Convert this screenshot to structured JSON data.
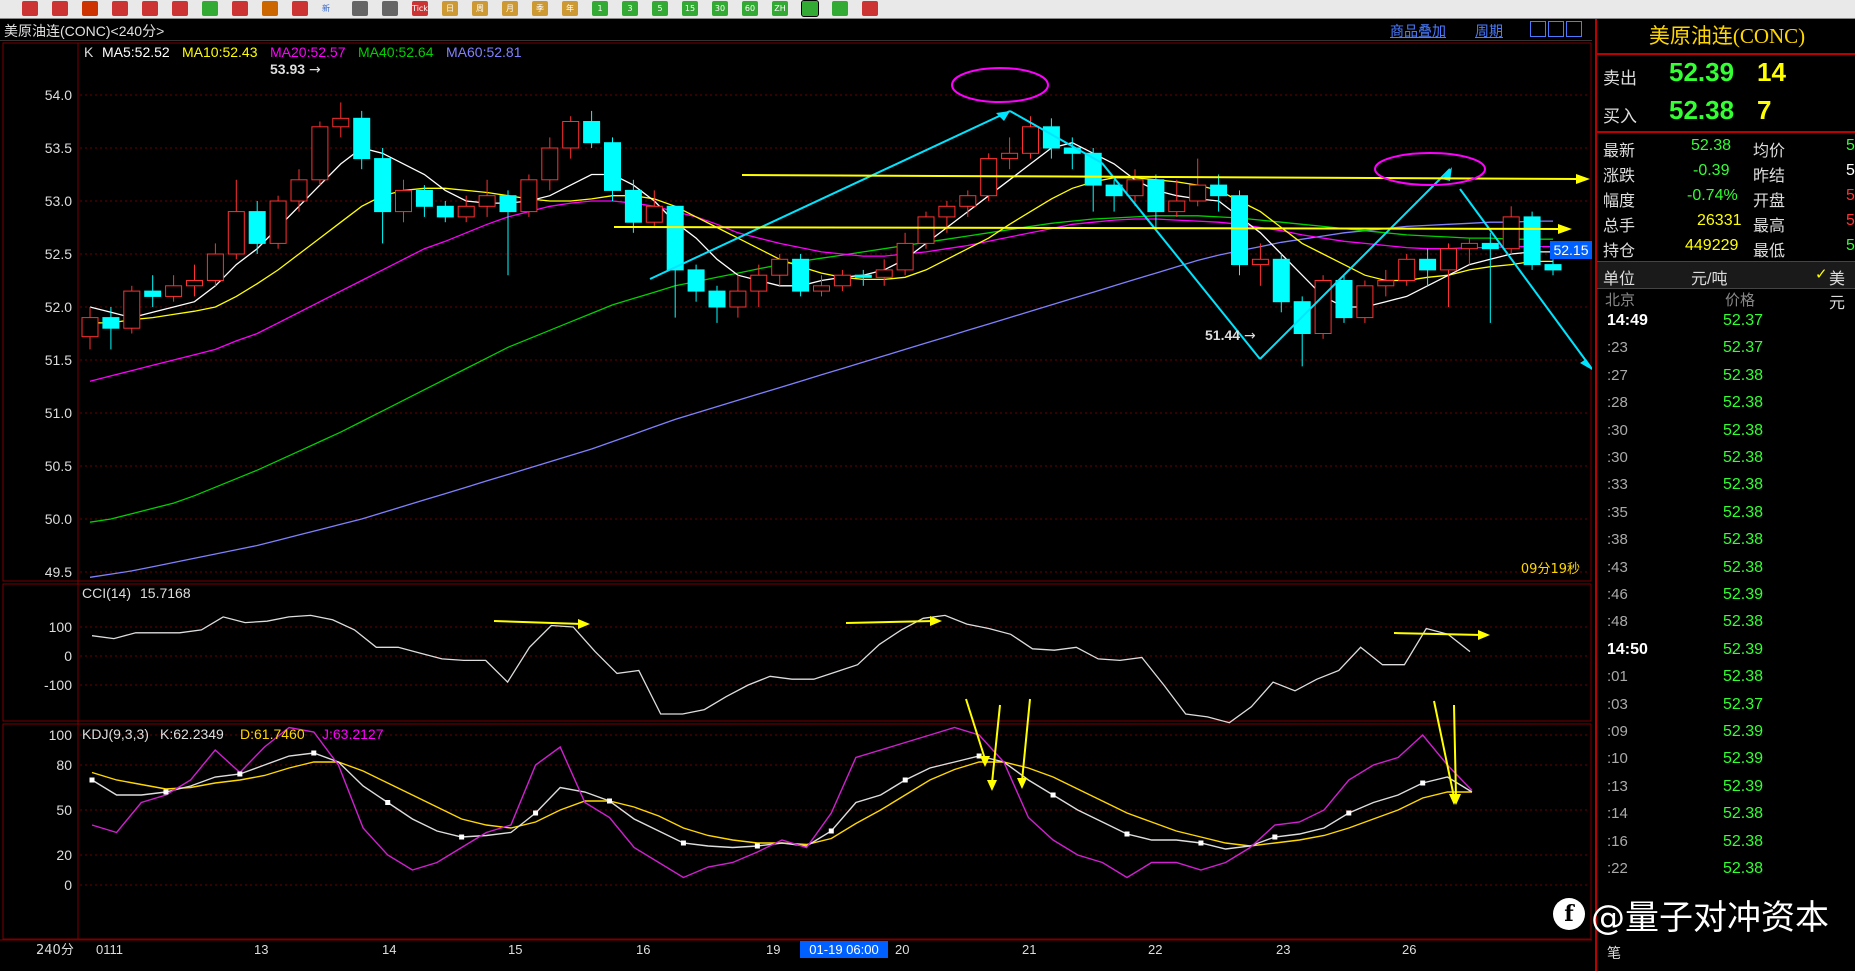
{
  "toolbar": {
    "tick_label": "Tick",
    "day_label": "日",
    "week_label": "周",
    "month_label": "月",
    "season_label": "季",
    "year_label": "年",
    "m1": "1",
    "m3": "3",
    "m5": "5",
    "m15": "15",
    "m30": "30",
    "m60": "60",
    "zh_label": "ZH",
    "fen_label": "新"
  },
  "header": {
    "title": "美原油连(CONC)<240分>",
    "overlay_link": "商品叠加",
    "period_link": "周期"
  },
  "main_legend": {
    "k": "K",
    "ma5": "MA5:52.52",
    "ma10": "MA10:52.43",
    "ma20": "MA20:52.57",
    "ma40": "MA40:52.64",
    "ma60": "MA60:52.81"
  },
  "colors": {
    "up": "#ff3030",
    "down": "#00ffff",
    "ma5": "#ffffff",
    "ma10": "#ffff00",
    "ma20": "#ff00ff",
    "ma40": "#00d000",
    "ma60": "#8080ff",
    "annotation_cyan": "#00e5ff",
    "annotation_yellow": "#ffff00",
    "annotation_magenta": "#ff00ff"
  },
  "annotations": {
    "high_label": "53.93",
    "low_label": "51.44",
    "current_price_tag": "52.15",
    "countdown": "09分19秒"
  },
  "cci": {
    "legend_name": "CCI(14)",
    "legend_value": "15.7168",
    "y_ticks": [
      "100",
      "0",
      "-100"
    ]
  },
  "kdj": {
    "legend_name": "KDJ(9,3,3)",
    "k": "K:62.2349",
    "d": "D:61.7460",
    "j": "J:63.2127",
    "y_ticks": [
      "100",
      "80",
      "50",
      "20",
      "0"
    ]
  },
  "xaxis": {
    "period": "240分",
    "labels": [
      "0111",
      "13",
      "14",
      "15",
      "16",
      "19",
      "20",
      "21",
      "22",
      "23",
      "26"
    ],
    "cursor_label": "01-19 06:00"
  },
  "chart_data": {
    "type": "candlestick",
    "ylim": [
      49.3,
      54.1
    ],
    "y_ticks": [
      "54.0",
      "53.5",
      "53.0",
      "52.5",
      "52.0",
      "51.5",
      "51.0",
      "50.5",
      "50.0",
      "49.5"
    ],
    "candles": [
      [
        51.72,
        51.9,
        51.6,
        52.0
      ],
      [
        51.9,
        51.8,
        51.6,
        52.0
      ],
      [
        51.8,
        52.15,
        51.75,
        52.2
      ],
      [
        52.15,
        52.1,
        52.0,
        52.3
      ],
      [
        52.1,
        52.2,
        52.05,
        52.3
      ],
      [
        52.2,
        52.25,
        52.1,
        52.4
      ],
      [
        52.25,
        52.5,
        52.2,
        52.6
      ],
      [
        52.5,
        52.9,
        52.45,
        53.2
      ],
      [
        52.9,
        52.6,
        52.5,
        53.0
      ],
      [
        52.6,
        53.0,
        52.55,
        53.05
      ],
      [
        53.0,
        53.2,
        52.9,
        53.3
      ],
      [
        53.2,
        53.7,
        53.15,
        53.75
      ],
      [
        53.7,
        53.78,
        53.6,
        53.93
      ],
      [
        53.78,
        53.4,
        53.3,
        53.85
      ],
      [
        53.4,
        52.9,
        52.6,
        53.5
      ],
      [
        52.9,
        53.1,
        52.8,
        53.2
      ],
      [
        53.1,
        52.95,
        52.85,
        53.15
      ],
      [
        52.95,
        52.85,
        52.8,
        53.0
      ],
      [
        52.85,
        52.95,
        52.8,
        53.05
      ],
      [
        52.95,
        53.05,
        52.85,
        53.2
      ],
      [
        53.05,
        52.9,
        52.3,
        53.1
      ],
      [
        52.9,
        53.2,
        52.85,
        53.25
      ],
      [
        53.2,
        53.5,
        53.1,
        53.6
      ],
      [
        53.5,
        53.75,
        53.4,
        53.8
      ],
      [
        53.75,
        53.55,
        53.5,
        53.85
      ],
      [
        53.55,
        53.1,
        53.0,
        53.6
      ],
      [
        53.1,
        52.8,
        52.7,
        53.2
      ],
      [
        52.8,
        52.95,
        52.75,
        53.1
      ],
      [
        52.95,
        52.35,
        51.9,
        52.95
      ],
      [
        52.35,
        52.15,
        52.05,
        52.4
      ],
      [
        52.15,
        52.0,
        51.85,
        52.2
      ],
      [
        52.0,
        52.15,
        51.9,
        52.3
      ],
      [
        52.15,
        52.3,
        52.0,
        52.4
      ],
      [
        52.3,
        52.45,
        52.2,
        52.5
      ],
      [
        52.45,
        52.15,
        52.1,
        52.5
      ],
      [
        52.15,
        52.2,
        52.1,
        52.3
      ],
      [
        52.2,
        52.3,
        52.15,
        52.35
      ],
      [
        52.3,
        52.28,
        52.2,
        52.35
      ],
      [
        52.28,
        52.35,
        52.2,
        52.45
      ],
      [
        52.35,
        52.6,
        52.3,
        52.7
      ],
      [
        52.6,
        52.85,
        52.55,
        52.9
      ],
      [
        52.85,
        52.95,
        52.7,
        53.0
      ],
      [
        52.95,
        53.05,
        52.85,
        53.1
      ],
      [
        53.05,
        53.4,
        53.0,
        53.45
      ],
      [
        53.4,
        53.45,
        53.3,
        53.6
      ],
      [
        53.45,
        53.7,
        53.4,
        53.8
      ],
      [
        53.7,
        53.5,
        53.4,
        53.78
      ],
      [
        53.5,
        53.45,
        53.3,
        53.6
      ],
      [
        53.45,
        53.15,
        52.9,
        53.5
      ],
      [
        53.15,
        53.05,
        52.9,
        53.2
      ],
      [
        53.05,
        53.2,
        52.95,
        53.3
      ],
      [
        53.2,
        52.9,
        52.75,
        53.25
      ],
      [
        52.9,
        53.0,
        52.85,
        53.2
      ],
      [
        53.0,
        53.15,
        52.95,
        53.4
      ],
      [
        53.15,
        53.05,
        52.9,
        53.25
      ],
      [
        53.05,
        52.4,
        52.3,
        53.1
      ],
      [
        52.4,
        52.45,
        52.2,
        52.6
      ],
      [
        52.45,
        52.05,
        51.95,
        52.5
      ],
      [
        52.05,
        51.75,
        51.44,
        52.1
      ],
      [
        51.75,
        52.25,
        51.7,
        52.3
      ],
      [
        52.25,
        51.9,
        51.85,
        52.3
      ],
      [
        51.9,
        52.2,
        51.85,
        52.25
      ],
      [
        52.2,
        52.25,
        52.1,
        52.35
      ],
      [
        52.25,
        52.45,
        52.2,
        52.5
      ],
      [
        52.45,
        52.35,
        52.2,
        52.55
      ],
      [
        52.35,
        52.55,
        52.0,
        52.6
      ],
      [
        52.55,
        52.6,
        52.4,
        52.65
      ],
      [
        52.6,
        52.55,
        51.85,
        52.7
      ],
      [
        52.55,
        52.85,
        52.5,
        52.95
      ],
      [
        52.85,
        52.4,
        52.35,
        52.9
      ],
      [
        52.4,
        52.35,
        52.3,
        52.45
      ]
    ],
    "ma5": [
      52.0,
      51.95,
      51.9,
      51.95,
      52.0,
      52.05,
      52.2,
      52.4,
      52.55,
      52.75,
      52.95,
      53.15,
      53.35,
      53.5,
      53.45,
      53.35,
      53.25,
      53.1,
      53.0,
      52.98,
      52.98,
      53.0,
      53.05,
      53.15,
      53.25,
      53.25,
      53.15,
      53.0,
      52.8,
      52.65,
      52.45,
      52.3,
      52.25,
      52.2,
      52.2,
      52.25,
      52.28,
      52.3,
      52.35,
      52.45,
      52.6,
      52.75,
      52.9,
      53.05,
      53.2,
      53.35,
      53.5,
      53.55,
      53.45,
      53.35,
      53.2,
      53.1,
      53.05,
      53.02,
      53.0,
      52.85,
      52.7,
      52.5,
      52.3,
      52.1,
      52.0,
      52.0,
      52.05,
      52.1,
      52.2,
      52.3,
      52.4,
      52.45,
      52.5,
      52.52,
      52.52
    ],
    "ma10": [
      51.85,
      51.85,
      51.88,
      51.9,
      51.93,
      51.96,
      52.0,
      52.1,
      52.22,
      52.35,
      52.5,
      52.65,
      52.8,
      52.95,
      53.05,
      53.1,
      53.12,
      53.12,
      53.1,
      53.08,
      53.05,
      53.02,
      53.0,
      53.0,
      53.02,
      53.05,
      53.05,
      53.02,
      52.95,
      52.85,
      52.75,
      52.65,
      52.55,
      52.45,
      52.38,
      52.32,
      52.28,
      52.26,
      52.26,
      52.28,
      52.35,
      52.45,
      52.55,
      52.65,
      52.78,
      52.9,
      53.02,
      53.12,
      53.18,
      53.22,
      53.22,
      53.2,
      53.18,
      53.15,
      53.1,
      53.0,
      52.9,
      52.75,
      52.6,
      52.5,
      52.4,
      52.3,
      52.25,
      52.25,
      52.28,
      52.3,
      52.35,
      52.38,
      52.4,
      52.43,
      52.43
    ],
    "ma20": [
      51.3,
      51.35,
      51.4,
      51.45,
      51.5,
      51.55,
      51.6,
      51.68,
      51.75,
      51.85,
      51.95,
      52.05,
      52.15,
      52.25,
      52.35,
      52.45,
      52.55,
      52.62,
      52.7,
      52.78,
      52.85,
      52.9,
      52.95,
      52.98,
      53.0,
      53.0,
      52.98,
      52.95,
      52.9,
      52.85,
      52.78,
      52.7,
      52.65,
      52.6,
      52.56,
      52.52,
      52.5,
      52.48,
      52.48,
      52.5,
      52.52,
      52.55,
      52.58,
      52.62,
      52.66,
      52.7,
      52.74,
      52.78,
      52.8,
      52.82,
      52.83,
      52.83,
      52.82,
      52.81,
      52.8,
      52.78,
      52.75,
      52.72,
      52.68,
      52.65,
      52.62,
      52.6,
      52.58,
      52.56,
      52.55,
      52.55,
      52.56,
      52.56,
      52.57,
      52.57,
      52.57
    ],
    "ma40": [
      49.97,
      50.0,
      50.05,
      50.1,
      50.15,
      50.22,
      50.3,
      50.38,
      50.46,
      50.55,
      50.64,
      50.73,
      50.82,
      50.92,
      51.02,
      51.12,
      51.22,
      51.32,
      51.42,
      51.52,
      51.62,
      51.7,
      51.78,
      51.86,
      51.94,
      52.02,
      52.08,
      52.14,
      52.2,
      52.24,
      52.28,
      52.32,
      52.36,
      52.4,
      52.43,
      52.46,
      52.49,
      52.52,
      52.55,
      52.58,
      52.61,
      52.64,
      52.67,
      52.7,
      52.73,
      52.76,
      52.79,
      52.81,
      52.83,
      52.84,
      52.85,
      52.86,
      52.86,
      52.86,
      52.85,
      52.84,
      52.82,
      52.8,
      52.78,
      52.76,
      52.74,
      52.72,
      52.7,
      52.68,
      52.67,
      52.66,
      52.65,
      52.65,
      52.64,
      52.64,
      52.64
    ],
    "ma60": [
      49.45,
      49.48,
      49.51,
      49.55,
      49.59,
      49.63,
      49.67,
      49.71,
      49.75,
      49.8,
      49.85,
      49.9,
      49.95,
      50.0,
      50.06,
      50.12,
      50.18,
      50.24,
      50.3,
      50.36,
      50.42,
      50.48,
      50.54,
      50.6,
      50.66,
      50.73,
      50.8,
      50.87,
      50.94,
      51.0,
      51.06,
      51.12,
      51.18,
      51.24,
      51.3,
      51.36,
      51.42,
      51.48,
      51.54,
      51.6,
      51.66,
      51.72,
      51.78,
      51.84,
      51.9,
      51.96,
      52.02,
      52.08,
      52.14,
      52.2,
      52.26,
      52.32,
      52.38,
      52.44,
      52.49,
      52.53,
      52.57,
      52.61,
      52.64,
      52.67,
      52.7,
      52.72,
      52.74,
      52.76,
      52.77,
      52.78,
      52.79,
      52.8,
      52.8,
      52.81,
      52.81
    ],
    "cci": [
      70,
      60,
      80,
      80,
      80,
      90,
      135,
      115,
      120,
      135,
      140,
      125,
      90,
      30,
      30,
      10,
      -10,
      -15,
      -15,
      -90,
      30,
      105,
      100,
      15,
      -60,
      -50,
      -200,
      -200,
      -185,
      -140,
      -100,
      -70,
      -80,
      -80,
      -55,
      -30,
      40,
      90,
      130,
      140,
      110,
      95,
      75,
      25,
      20,
      30,
      -10,
      -15,
      -5,
      -100,
      -200,
      -210,
      -230,
      -175,
      -90,
      -120,
      -80,
      -50,
      30,
      -30,
      -30,
      95,
      75,
      15
    ],
    "kdj_k": [
      70,
      60,
      60,
      62,
      66,
      72,
      74,
      80,
      86,
      88,
      82,
      66,
      55,
      44,
      36,
      32,
      33,
      35,
      48,
      65,
      62,
      56,
      44,
      36,
      28,
      26,
      25,
      26,
      28,
      26,
      36,
      55,
      60,
      70,
      78,
      82,
      86,
      82,
      70,
      60,
      50,
      42,
      34,
      30,
      30,
      28,
      24,
      26,
      32,
      34,
      38,
      48,
      55,
      60,
      68,
      72,
      62
    ],
    "kdj_d": [
      75,
      70,
      67,
      64,
      65,
      68,
      70,
      73,
      78,
      82,
      82,
      76,
      68,
      60,
      52,
      44,
      40,
      38,
      42,
      50,
      56,
      56,
      52,
      46,
      38,
      33,
      30,
      28,
      28,
      27,
      31,
      41,
      50,
      60,
      70,
      77,
      82,
      82,
      78,
      72,
      64,
      56,
      48,
      42,
      36,
      32,
      28,
      26,
      28,
      30,
      33,
      38,
      44,
      50,
      58,
      62,
      62
    ],
    "kdj_j": [
      40,
      35,
      55,
      60,
      70,
      90,
      75,
      92,
      105,
      102,
      80,
      38,
      20,
      10,
      15,
      25,
      35,
      40,
      80,
      92,
      55,
      45,
      25,
      15,
      5,
      12,
      15,
      22,
      30,
      25,
      48,
      85,
      90,
      95,
      100,
      105,
      100,
      82,
      45,
      30,
      20,
      15,
      5,
      15,
      15,
      10,
      15,
      25,
      40,
      42,
      50,
      70,
      80,
      85,
      100,
      80,
      63
    ]
  },
  "quote": {
    "symbol_title": "美原油连(CONC)",
    "sell_label": "卖出",
    "sell_price": "52.39",
    "sell_vol": "14",
    "buy_label": "买入",
    "buy_price": "52.38",
    "buy_vol": "7"
  },
  "stats": {
    "latest_label": "最新",
    "latest": "52.38",
    "avg_label": "均价",
    "avg": "5",
    "change_label": "涨跌",
    "change": "-0.39",
    "prev_label": "昨结",
    "prev": "5",
    "pct_label": "幅度",
    "pct": "-0.74%",
    "open_label": "开盘",
    "open": "5",
    "vol_label": "总手",
    "vol": "26331",
    "high_label": "最高",
    "high": "5",
    "oi_label": "持仓",
    "oi": "449229",
    "low_label": "最低",
    "low": "5"
  },
  "unit_row": {
    "unit_label": "单位",
    "unit_value": "元/吨",
    "usd_label": "美元"
  },
  "ticks": {
    "col_city": "北京",
    "col_price": "价格",
    "footer": "笔",
    "rows": [
      {
        "time": "14:49",
        "price": "52.37"
      },
      {
        "time": ":23",
        "price": "52.37"
      },
      {
        "time": ":27",
        "price": "52.38"
      },
      {
        "time": ":28",
        "price": "52.38"
      },
      {
        "time": ":30",
        "price": "52.38"
      },
      {
        "time": ":30",
        "price": "52.38"
      },
      {
        "time": ":33",
        "price": "52.38"
      },
      {
        "time": ":35",
        "price": "52.38"
      },
      {
        "time": ":38",
        "price": "52.38"
      },
      {
        "time": ":43",
        "price": "52.38"
      },
      {
        "time": ":46",
        "price": "52.39"
      },
      {
        "time": ":48",
        "price": "52.38"
      },
      {
        "time": "14:50",
        "price": "52.39"
      },
      {
        "time": ":01",
        "price": "52.38"
      },
      {
        "time": ":03",
        "price": "52.37"
      },
      {
        "time": ":09",
        "price": "52.39"
      },
      {
        "time": ":10",
        "price": "52.39"
      },
      {
        "time": ":13",
        "price": "52.39"
      },
      {
        "time": ":14",
        "price": "52.38"
      },
      {
        "time": ":16",
        "price": "52.38"
      },
      {
        "time": ":22",
        "price": "52.38"
      }
    ]
  },
  "watermark": {
    "icon_char": "f",
    "text": "@量子对冲资本"
  }
}
